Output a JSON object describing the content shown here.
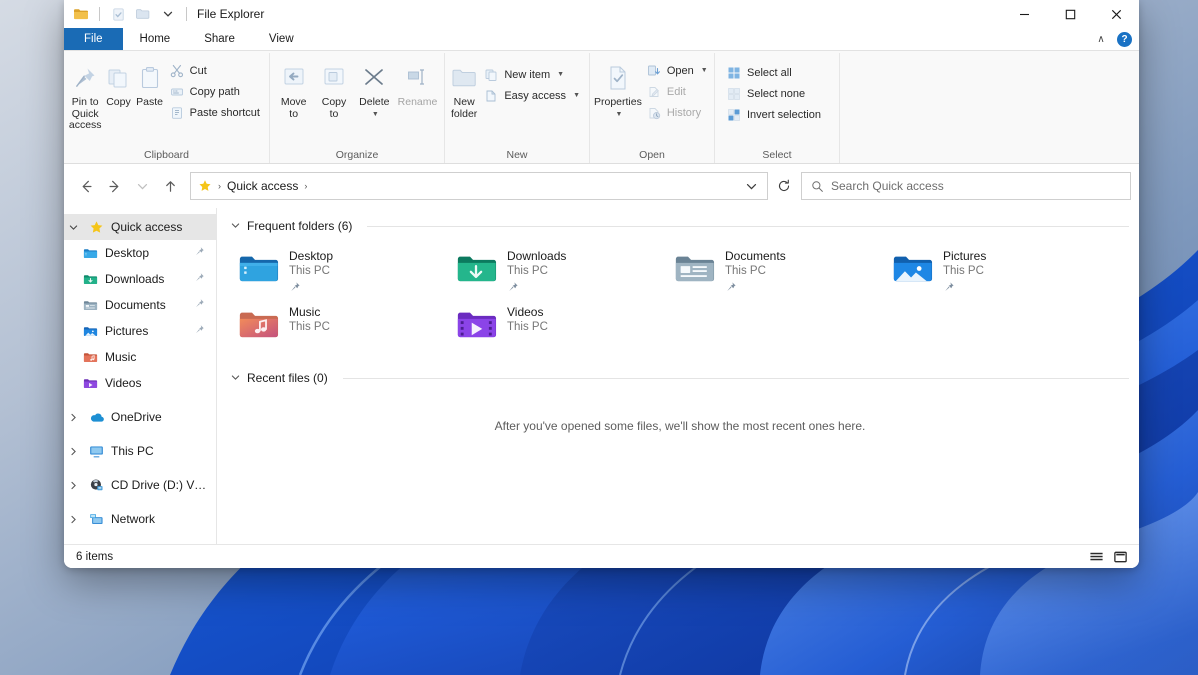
{
  "window": {
    "title": "File Explorer",
    "quick_access_toolbar": [
      {
        "name": "folder-icon",
        "label": "File Explorer"
      },
      {
        "name": "properties-icon",
        "label": "Properties"
      },
      {
        "name": "new-folder-icon",
        "label": "New folder"
      },
      {
        "name": "chevron-down-icon",
        "label": "Customize Quick Access Toolbar"
      }
    ],
    "controls": {
      "minimize": "–",
      "maximize": "❑",
      "close": "✕"
    }
  },
  "ribbon": {
    "tabs": [
      {
        "label": "File",
        "active": false,
        "accent": true
      },
      {
        "label": "Home",
        "active": true,
        "accent": false
      },
      {
        "label": "Share",
        "active": false,
        "accent": false
      },
      {
        "label": "View",
        "active": false,
        "accent": false
      }
    ],
    "collapse_label": "∧",
    "help_label": "?",
    "groups": [
      {
        "label": "Clipboard",
        "big_buttons": [
          {
            "label": "Pin to Quick\naccess",
            "icon": "pin-icon",
            "disabled": false
          },
          {
            "label": "Copy",
            "icon": "copy-icon",
            "disabled": false
          },
          {
            "label": "Paste",
            "icon": "paste-icon",
            "disabled": false
          }
        ],
        "small_buttons": [
          {
            "label": "Cut",
            "icon": "scissors-icon",
            "disabled": false,
            "caret": false
          },
          {
            "label": "Copy path",
            "icon": "copy-path-icon",
            "disabled": false,
            "caret": false
          },
          {
            "label": "Paste shortcut",
            "icon": "paste-shortcut-icon",
            "disabled": false,
            "caret": false
          }
        ]
      },
      {
        "label": "Organize",
        "big_buttons": [
          {
            "label": "Move\nto",
            "icon": "move-to-icon",
            "disabled": false,
            "caret": true
          },
          {
            "label": "Copy\nto",
            "icon": "copy-to-icon",
            "disabled": false,
            "caret": true
          },
          {
            "label": "Delete",
            "icon": "delete-icon",
            "disabled": false,
            "caret": true
          },
          {
            "label": "Rename",
            "icon": "rename-icon",
            "disabled": true,
            "caret": false
          }
        ],
        "small_buttons": []
      },
      {
        "label": "New",
        "big_buttons": [
          {
            "label": "New\nfolder",
            "icon": "new-folder-icon",
            "disabled": false,
            "caret": false
          }
        ],
        "small_buttons": [
          {
            "label": "New item",
            "icon": "new-item-icon",
            "disabled": false,
            "caret": true
          },
          {
            "label": "Easy access",
            "icon": "easy-access-icon",
            "disabled": false,
            "caret": true
          }
        ]
      },
      {
        "label": "Open",
        "big_buttons": [
          {
            "label": "Properties",
            "icon": "properties-icon",
            "disabled": false,
            "caret": true
          }
        ],
        "small_buttons": [
          {
            "label": "Open",
            "icon": "open-icon",
            "disabled": false,
            "caret": true
          },
          {
            "label": "Edit",
            "icon": "edit-icon",
            "disabled": true,
            "caret": false
          },
          {
            "label": "History",
            "icon": "history-icon",
            "disabled": true,
            "caret": false
          }
        ]
      },
      {
        "label": "Select",
        "big_buttons": [],
        "small_buttons": [
          {
            "label": "Select all",
            "icon": "select-all-icon",
            "disabled": false,
            "caret": false
          },
          {
            "label": "Select none",
            "icon": "select-none-icon",
            "disabled": false,
            "caret": false
          },
          {
            "label": "Invert selection",
            "icon": "invert-selection-icon",
            "disabled": false,
            "caret": false
          }
        ]
      }
    ]
  },
  "navigation": {
    "back_label": "←",
    "forward_label": "→",
    "recent_label": "∨",
    "up_label": "↑",
    "breadcrumb": {
      "icon": "star-icon",
      "items": [
        "Quick access"
      ],
      "separator": "›"
    },
    "address_dropdown": "∨",
    "refresh_label": "↻",
    "search": {
      "icon": "search-icon",
      "placeholder": "Search Quick access",
      "value": ""
    }
  },
  "sidebar": {
    "items": [
      {
        "label": "Quick access",
        "icon": "star-icon",
        "expander": "∨",
        "indent": false,
        "selected": true,
        "pinned": false
      },
      {
        "label": "Desktop",
        "icon": "desktop-folder-icon",
        "expander": "",
        "indent": true,
        "selected": false,
        "pinned": true
      },
      {
        "label": "Downloads",
        "icon": "downloads-folder-icon",
        "expander": "",
        "indent": true,
        "selected": false,
        "pinned": true
      },
      {
        "label": "Documents",
        "icon": "documents-folder-icon",
        "expander": "",
        "indent": true,
        "selected": false,
        "pinned": true
      },
      {
        "label": "Pictures",
        "icon": "pictures-folder-icon",
        "expander": "",
        "indent": true,
        "selected": false,
        "pinned": true
      },
      {
        "label": "Music",
        "icon": "music-folder-icon",
        "expander": "",
        "indent": true,
        "selected": false,
        "pinned": false
      },
      {
        "label": "Videos",
        "icon": "videos-folder-icon",
        "expander": "",
        "indent": true,
        "selected": false,
        "pinned": false
      },
      {
        "label": "OneDrive",
        "icon": "onedrive-icon",
        "expander": "›",
        "indent": false,
        "selected": false,
        "pinned": false
      },
      {
        "label": "This PC",
        "icon": "this-pc-icon",
        "expander": "›",
        "indent": false,
        "selected": false,
        "pinned": false
      },
      {
        "label": "CD Drive (D:) VirtualB",
        "icon": "cd-drive-icon",
        "expander": "›",
        "indent": false,
        "selected": false,
        "pinned": false
      },
      {
        "label": "Network",
        "icon": "network-icon",
        "expander": "›",
        "indent": false,
        "selected": false,
        "pinned": false
      }
    ]
  },
  "content": {
    "frequent_folders": {
      "heading": "Frequent folders (6)",
      "chevron": "∨",
      "tiles": [
        {
          "name": "Desktop",
          "sub": "This PC",
          "icon": "desktop-folder-icon",
          "pinned": true
        },
        {
          "name": "Downloads",
          "sub": "This PC",
          "icon": "downloads-folder-icon",
          "pinned": true
        },
        {
          "name": "Documents",
          "sub": "This PC",
          "icon": "documents-folder-icon",
          "pinned": true
        },
        {
          "name": "Pictures",
          "sub": "This PC",
          "icon": "pictures-folder-icon",
          "pinned": true
        },
        {
          "name": "Music",
          "sub": "This PC",
          "icon": "music-folder-icon",
          "pinned": false
        },
        {
          "name": "Videos",
          "sub": "This PC",
          "icon": "videos-folder-icon",
          "pinned": false
        }
      ]
    },
    "recent_files": {
      "heading": "Recent files (0)",
      "chevron": "∨",
      "empty_message": "After you've opened some files, we'll show the most recent ones here."
    }
  },
  "statusbar": {
    "item_count": "6 items",
    "view_buttons": [
      {
        "name": "details-view-button",
        "label": "Details view"
      },
      {
        "name": "large-icons-view-button",
        "label": "Large icons view"
      }
    ]
  },
  "colors": {
    "accent": "#1a6bb5",
    "help_blue": "#1a72c4",
    "selection": "#e6e6e6",
    "hover": "#f1f7fd",
    "star_yellow": "#f5c518"
  }
}
